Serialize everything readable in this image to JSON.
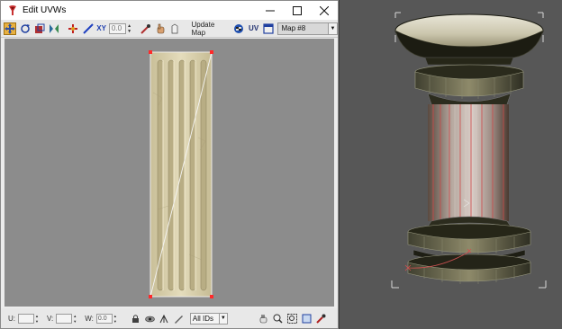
{
  "window": {
    "title": "Edit UVWs",
    "controls": [
      "minimize-icon",
      "maximize-icon",
      "close-icon"
    ]
  },
  "toolbar": {
    "left_icons": [
      "move-icon",
      "rotate-icon",
      "scale-icon",
      "mirror-icon",
      "freeform-icon",
      "link-icon"
    ],
    "xy_label": "XY",
    "spinner_value": "0.0",
    "tool_icons": [
      "pick-icon",
      "hand-icon",
      "pan-icon"
    ],
    "update_map_label": "Update Map",
    "view_icons": [
      "checker-icon",
      "uv-icon",
      "window-icon"
    ],
    "uv_label": "UV",
    "map_select": "Map #8"
  },
  "status_bar": {
    "u_label": "U:",
    "v_label": "V:",
    "w_label": "W:",
    "u_value": "",
    "v_value": "",
    "w_value": "0.0",
    "lock_icons": [
      "lock-icon",
      "eye-icon",
      "gizmo-icon",
      "pencil-icon"
    ],
    "ids_select": "All IDs",
    "nav_icons": [
      "pan-hand-icon",
      "zoom-icon",
      "zoom-region-icon",
      "zoom-extents-icon",
      "snap-icon"
    ]
  },
  "colors": {
    "uv_canvas_bg": "#8c8c8c",
    "viewport_bg": "#575757",
    "vertex_selected": "#ff2a2a",
    "texture_tone": "#d8d0b0",
    "seam_red": "#d03030",
    "column_dark": "#1a1a10"
  }
}
